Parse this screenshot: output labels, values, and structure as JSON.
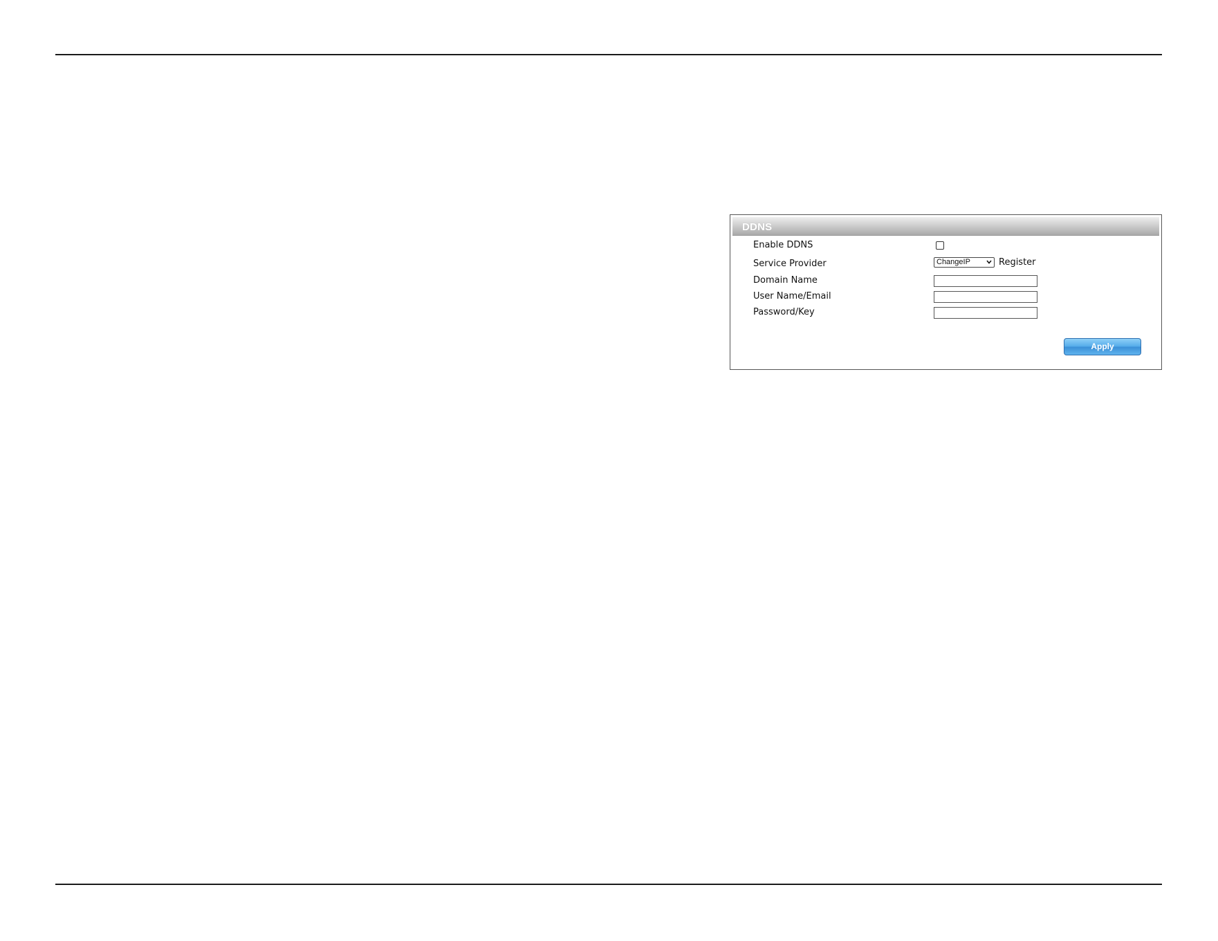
{
  "ddns": {
    "title": "DDNS",
    "enable_label": "Enable DDNS",
    "enable_checked": false,
    "provider_label": "Service Provider",
    "provider_selected": "ChangeIP",
    "register_label": "Register",
    "domain_label": "Domain Name",
    "domain_value": "",
    "user_label": "User Name/Email",
    "user_value": "",
    "password_label": "Password/Key",
    "password_value": "",
    "apply_label": "Apply"
  },
  "icons": {
    "select_arrow": "chevron-down-icon"
  },
  "colors": {
    "apply_button": "#4fa3e8",
    "header_gradient_top": "#eeeeee",
    "header_gradient_bottom": "#a9a9a9"
  }
}
